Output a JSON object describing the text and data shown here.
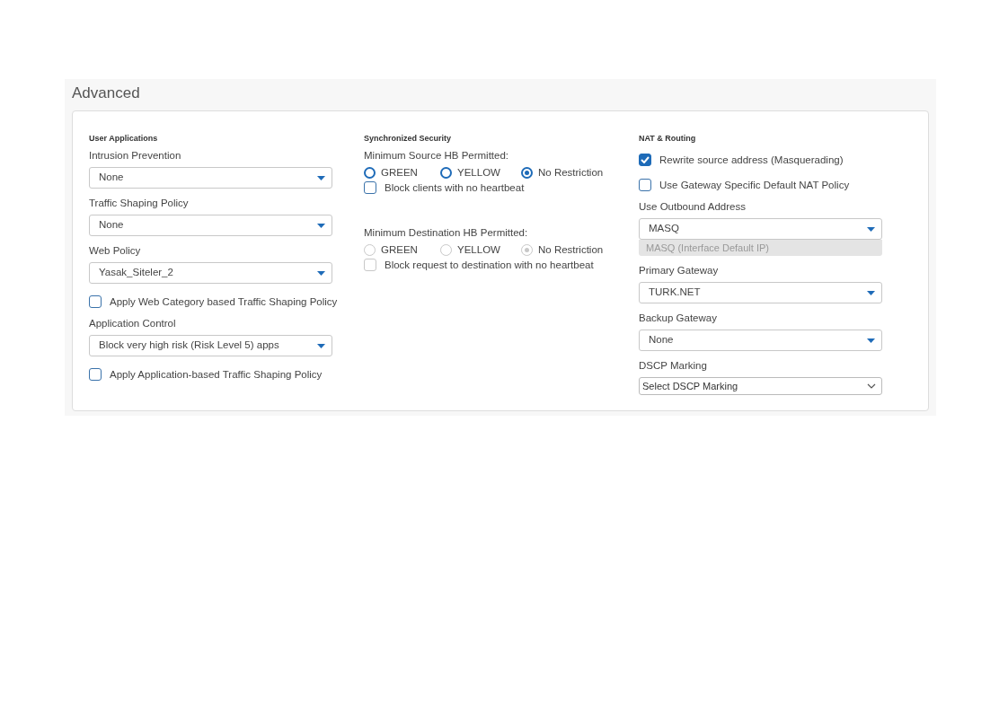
{
  "section_title": "Advanced",
  "columns": [
    {
      "heading": "User Applications",
      "groups": [
        [
          {
            "kind": "label",
            "text": "Intrusion Prevention"
          },
          {
            "kind": "select",
            "value": "None"
          },
          {
            "kind": "label",
            "text": "Traffic Shaping Policy"
          },
          {
            "kind": "select",
            "value": "None"
          },
          {
            "kind": "label",
            "text": "Web Policy"
          },
          {
            "kind": "select",
            "value": "Yasak_Siteler_2"
          },
          {
            "kind": "checkbox",
            "text": "Apply Web Category based Traffic Shaping Policy",
            "checked": false,
            "disabled": false
          },
          {
            "kind": "label",
            "text": "Application Control"
          },
          {
            "kind": "select",
            "value": "Block very high risk (Risk Level 5) apps"
          },
          {
            "kind": "checkbox",
            "text": "Apply Application-based Traffic Shaping Policy",
            "checked": false,
            "disabled": false
          }
        ]
      ]
    },
    {
      "heading": "Synchronized Security",
      "groups": [
        [
          {
            "kind": "label",
            "text": "Minimum Source HB Permitted:"
          },
          {
            "kind": "radios",
            "disabled": false,
            "options": [
              {
                "text": "GREEN",
                "selected": false
              },
              {
                "text": "YELLOW",
                "selected": false
              },
              {
                "text": "No Restriction",
                "selected": true
              }
            ]
          },
          {
            "kind": "checkbox",
            "text": "Block clients with no heartbeat",
            "checked": false,
            "disabled": false
          }
        ],
        [
          {
            "kind": "label",
            "text": "Minimum Destination HB Permitted:"
          },
          {
            "kind": "radios",
            "disabled": true,
            "options": [
              {
                "text": "GREEN",
                "selected": false
              },
              {
                "text": "YELLOW",
                "selected": false
              },
              {
                "text": "No Restriction",
                "selected": true
              }
            ]
          },
          {
            "kind": "checkbox",
            "text": "Block request to destination with no heartbeat",
            "checked": false,
            "disabled": true
          }
        ]
      ]
    },
    {
      "heading": "NAT & Routing",
      "groups": [
        [
          {
            "kind": "checkbox",
            "text": "Rewrite source address (Masquerading)",
            "checked": true,
            "disabled": false
          },
          {
            "kind": "checkbox",
            "text": "Use Gateway Specific Default NAT Policy",
            "checked": false,
            "disabled": false
          },
          {
            "kind": "label",
            "text": "Use Outbound Address"
          },
          {
            "kind": "select",
            "value": "MASQ"
          },
          {
            "kind": "hint",
            "text": "MASQ (Interface Default IP)"
          },
          {
            "kind": "label",
            "text": "Primary Gateway"
          },
          {
            "kind": "select",
            "value": "TURK.NET"
          },
          {
            "kind": "label",
            "text": "Backup Gateway"
          },
          {
            "kind": "select",
            "value": "None"
          },
          {
            "kind": "label",
            "text": "DSCP Marking"
          },
          {
            "kind": "native_select",
            "value": "Select DSCP Marking"
          }
        ]
      ]
    }
  ]
}
